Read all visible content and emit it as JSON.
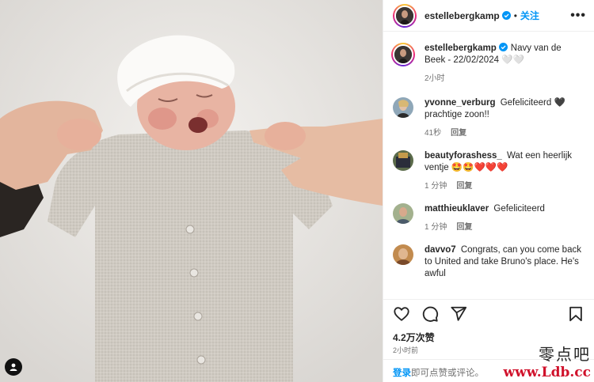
{
  "post": {
    "username": "estellebergkamp",
    "follow_label": "关注",
    "more_label": "•••",
    "dot": "•"
  },
  "caption": {
    "username": "estellebergkamp",
    "text": "Navy van de Beek - 22/02/2024 🤍🤍",
    "time": "2小时"
  },
  "comments": [
    {
      "user": "yvonne_verburg",
      "text": "Gefeliciteerd 🖤 prachtige zoon!!",
      "time": "41秒",
      "reply": "回复"
    },
    {
      "user": "beautyforashess_",
      "text": "Wat een heerlijk ventje 🤩🤩❤️❤️❤️",
      "time": "1 分钟",
      "reply": "回复"
    },
    {
      "user": "matthieuklaver",
      "text": "Gefeliciteerd",
      "time": "1 分钟",
      "reply": "回复"
    },
    {
      "user": "davvo7",
      "text": "Congrats, can you come back to United and take Bruno's place. He's awful",
      "time": "",
      "reply": ""
    }
  ],
  "likes": "4.2万次赞",
  "post_time": "2小时前",
  "footer": {
    "login": "登录",
    "rest": "即可点赞或评论。"
  },
  "watermark": {
    "line1": "零点吧",
    "line2": "www.Ldb.cc"
  },
  "colors": {
    "accent": "#0095f6",
    "verified": "#0095f6",
    "secondary_text": "#737373"
  }
}
